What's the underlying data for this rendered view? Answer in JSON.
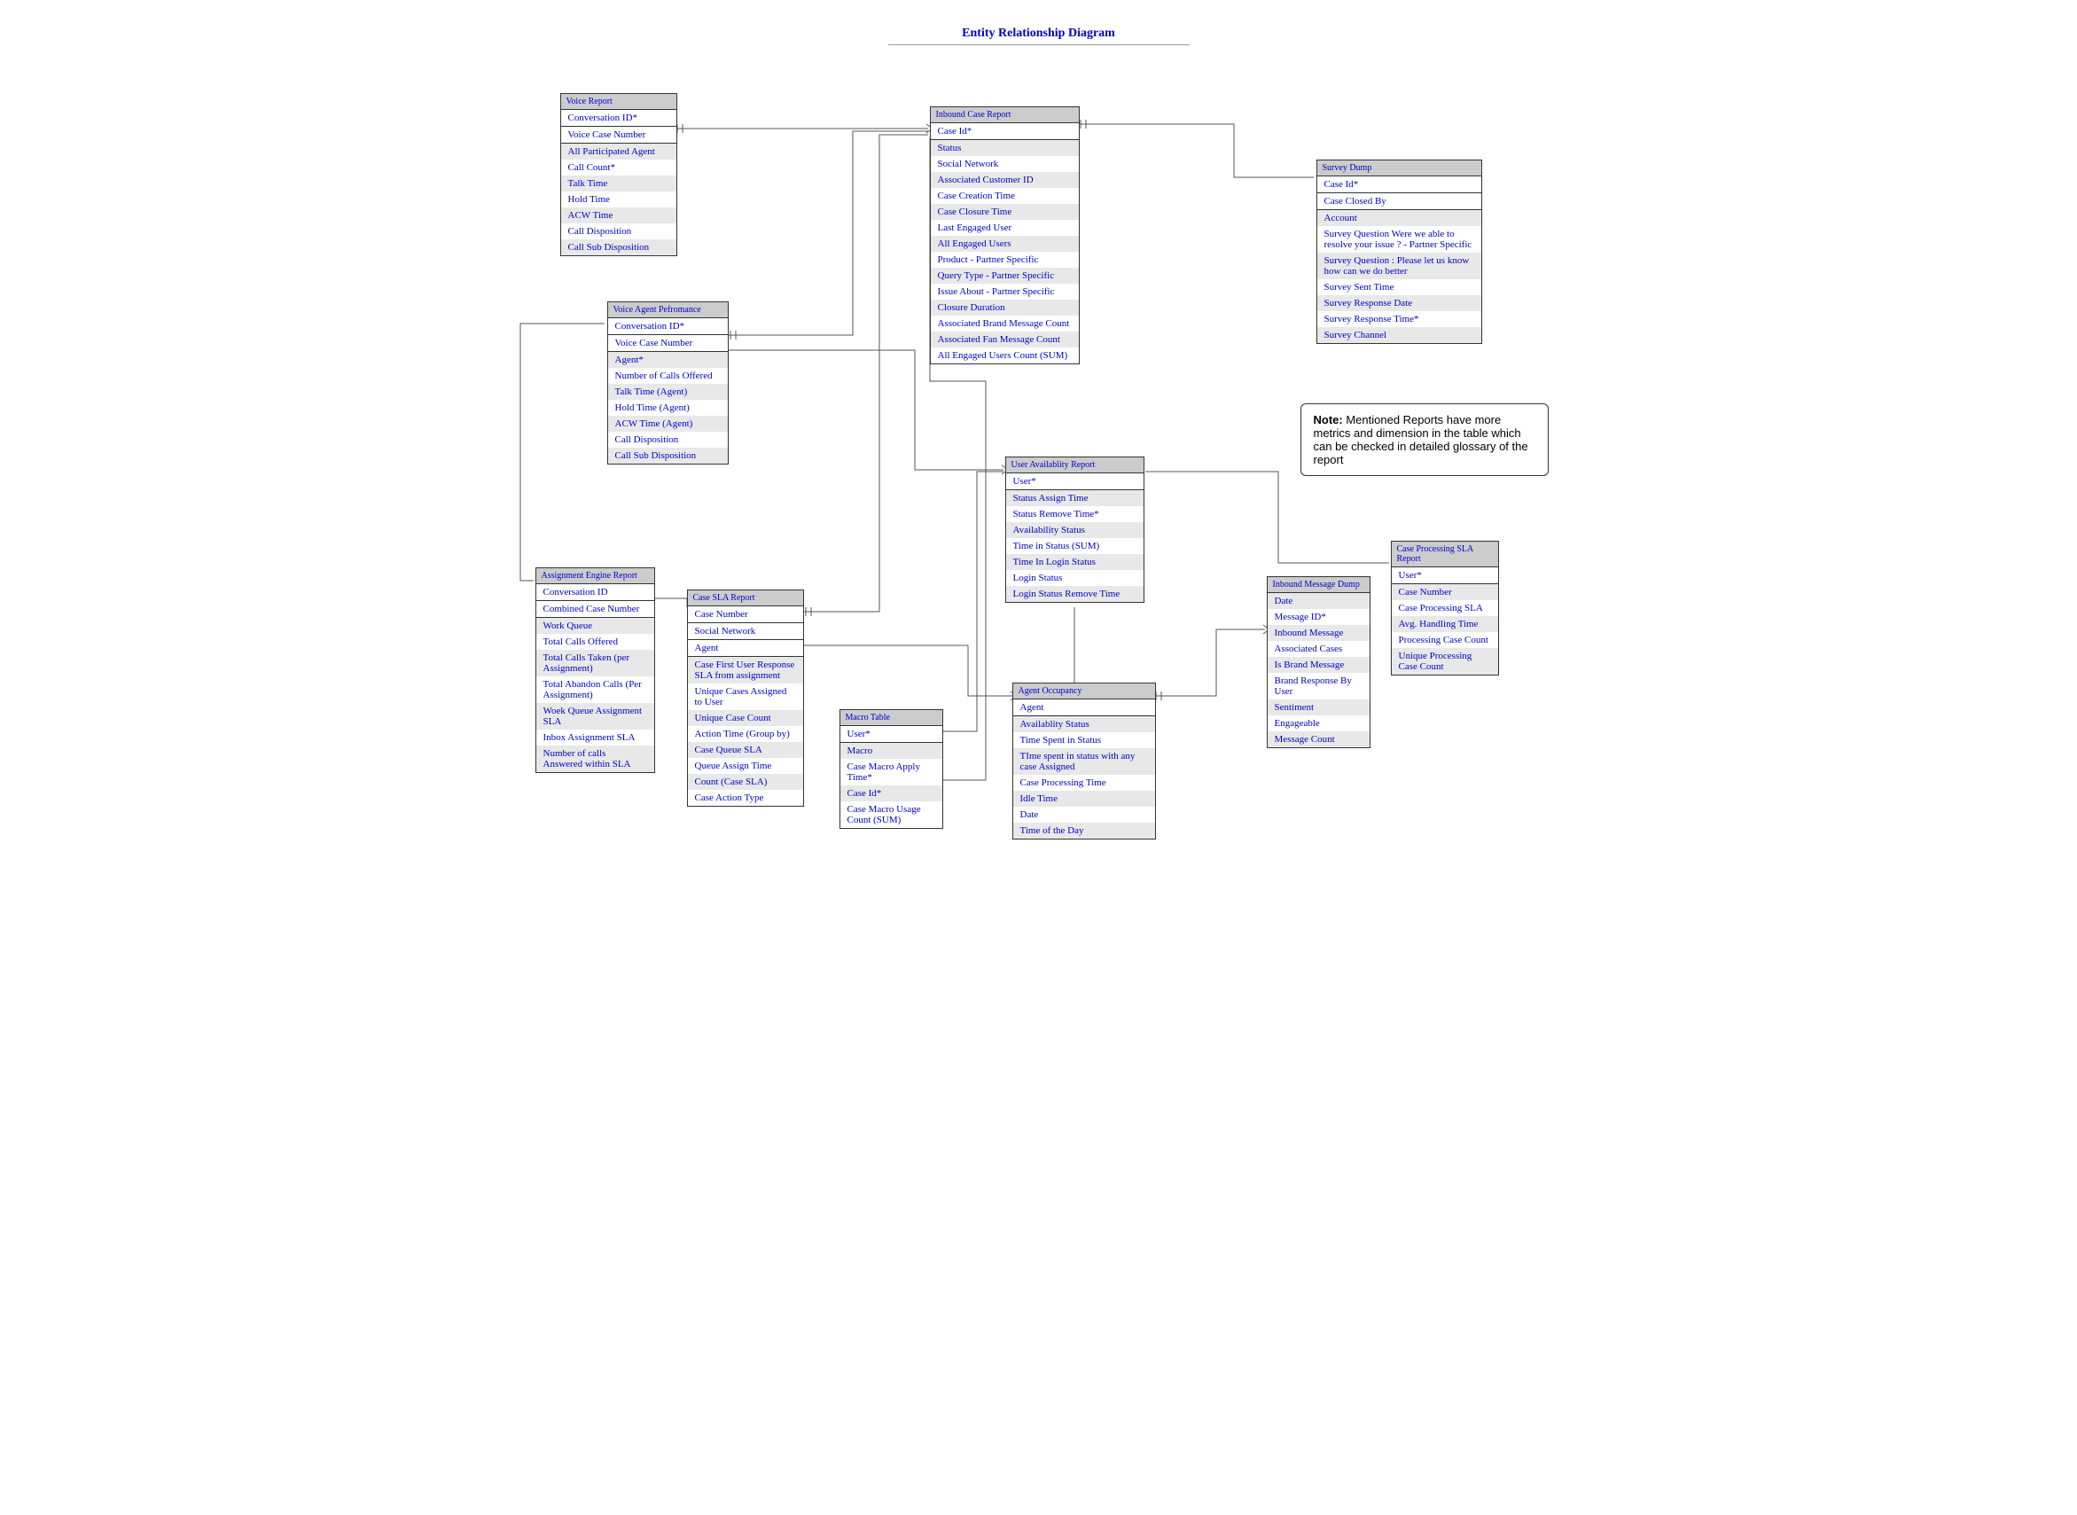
{
  "title": "Entity Relationship Diagram",
  "note": {
    "label": "Note:",
    "text": "Mentioned Reports have more metrics and dimension in the table which can be checked in detailed glossary of the report"
  },
  "entities": {
    "voice_report": {
      "header": "Voice Report",
      "rows": [
        "Conversation ID*",
        "Voice Case Number",
        "All Participated Agent",
        "Call Count*",
        "Talk Time",
        "Hold Time",
        "ACW Time",
        "Call Disposition",
        "Call Sub Disposition"
      ]
    },
    "voice_agent": {
      "header": "Voice  Agent Pefromance",
      "rows": [
        "Conversation ID*",
        "Voice Case Number",
        "Agent*",
        "Number of Calls Offered",
        "Talk Time (Agent)",
        "Hold Time (Agent)",
        "ACW Time (Agent)",
        "Call Disposition",
        "Call Sub Disposition"
      ]
    },
    "assignment": {
      "header": "Assignment Engine Report",
      "rows": [
        "Conversation ID",
        "Combined Case Number",
        "Work Queue",
        "Total Calls Offered",
        "Total Calls Taken (per Assignment)",
        "Total Abandon Calls (Per Assignment)",
        "Woek Queue Assignment SLA",
        "Inbox Assignment SLA",
        "Number of calls Answered within SLA"
      ]
    },
    "case_sla": {
      "header": "Case SLA Report",
      "rows": [
        "Case Number",
        "Social Network",
        "Agent",
        "Case First User Response SLA from assignment",
        "Unique Cases Assigned to User",
        "Unique Case Count",
        "Action Time (Group by)",
        "Case Queue SLA",
        "Queue Assign Time",
        "Count (Case SLA)",
        "Case Action Type"
      ]
    },
    "inbound_case": {
      "header": "Inbound Case Report",
      "rows": [
        "Case Id*",
        "Status",
        "Social Network",
        "Associated Customer ID",
        "Case Creation Time",
        "Case Closure Time",
        "Last Engaged User",
        "All Engaged Users",
        "Product - Partner Specific",
        "Query Type - Partner Specific",
        "Issue About - Partner Specific",
        "Closure Duration",
        "Associated Brand Message Count",
        "Associated Fan Message Count",
        "All Engaged Users Count (SUM)"
      ]
    },
    "user_avail": {
      "header": "User Availablity Report",
      "rows": [
        "User*",
        "Status Assign Time",
        "Status Remove Time*",
        "Availability Status",
        "Time in   Status (SUM)",
        "Time In Login Status",
        "Login Status",
        "Login Status Remove Time"
      ]
    },
    "macro": {
      "header": "Macro Table",
      "rows": [
        "User*",
        "Macro",
        "Case Macro Apply Time*",
        "Case Id*",
        "Case Macro   Usage Count (SUM)"
      ]
    },
    "agent_occ": {
      "header": "Agent Occupancy",
      "rows": [
        "Agent",
        "Availablity Status",
        "Time Spent in Status",
        "TIme spent in status with any case Assigned",
        "Case Processing Time",
        "Idle Time",
        "Date",
        "Time of the Day"
      ]
    },
    "survey": {
      "header": "Survey Dump",
      "rows": [
        "Case Id*",
        "Case Closed By",
        "Account",
        "Survey Question Were we able to resolve your issue ? - Partner Specific",
        "Survey Question : Please let us know how can we do better",
        "Survey Sent Time",
        "Survey Response Date",
        "Survey Response Time*",
        "Survey Channel"
      ]
    },
    "inbound_msg": {
      "header": "Inbound Message Dump",
      "rows": [
        "Date",
        "Message ID*",
        "Inbound Message",
        "Associated Cases",
        "Is Brand   Message",
        "Brand Response By User",
        "Sentiment",
        "Engageable",
        "Message Count"
      ]
    },
    "case_proc": {
      "header": "Case Processing SLA Report",
      "rows": [
        "User*",
        "Case Number",
        "Case Processing SLA",
        "Avg. Handling Time",
        "Processing Case Count",
        "Unique Processing Case Count"
      ]
    }
  }
}
